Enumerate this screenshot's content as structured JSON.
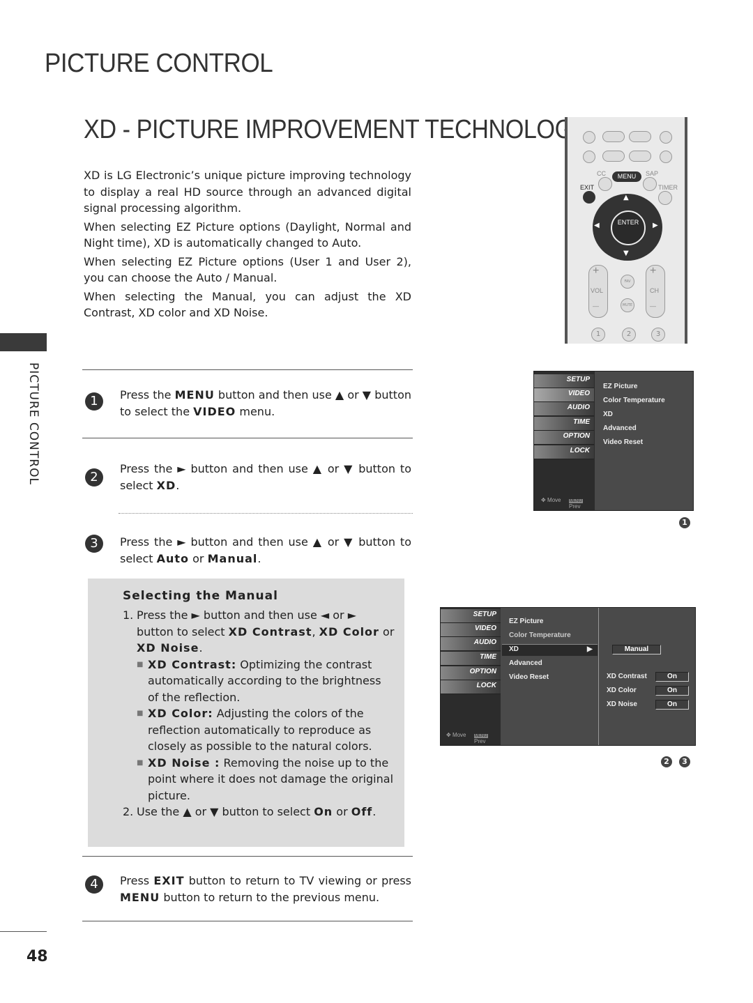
{
  "header": {
    "section_title": "PICTURE CONTROL",
    "page_title": "XD - PICTURE IMPROVEMENT TECHNOLOGY",
    "side_label": "PICTURE CONTROL",
    "page_number": "48"
  },
  "intro": [
    "XD is LG Electronic’s unique picture improving technology to display a real HD source through an advanced digital signal processing algorithm.",
    "When selecting EZ Picture options (Daylight, Normal and Night time), XD is automatically changed to Auto.",
    "When selecting EZ Picture options (User 1 and User 2), you can choose the Auto / Manual.",
    "When selecting the Manual, you can adjust the XD Contrast, XD color and XD Noise."
  ],
  "steps": [
    {
      "num": "1",
      "parts": [
        "Press the ",
        "MENU",
        " button and then use ▲ or ▼ button to select the ",
        "VIDEO",
        " menu."
      ]
    },
    {
      "num": "2",
      "parts": [
        "Press the ► button and then use ▲ or ▼ button to select ",
        "XD",
        "."
      ]
    },
    {
      "num": "3",
      "parts": [
        "Press the ► button and then use ▲ or ▼ button to select ",
        "Auto",
        " or ",
        "Manual",
        "."
      ]
    },
    {
      "num": "4",
      "parts": [
        "Press ",
        "EXIT",
        " button to return to TV viewing or press ",
        "MENU",
        " button to return to the previous menu."
      ]
    }
  ],
  "manual_box": {
    "title": "Selecting the Manual",
    "item1": {
      "num": "1.",
      "parts": [
        "Press the ► button and then use ◄ or ► button to select ",
        "XD Contrast",
        ", ",
        "XD Color",
        " or ",
        "XD Noise",
        "."
      ]
    },
    "bullets": [
      {
        "term": "XD Contrast:",
        "text": " Optimizing the contrast automatically according to the brightness of the reflection."
      },
      {
        "term": "XD Color:",
        "text": " Adjusting the colors of the reflection automatically to reproduce as closely as possible to the natural colors."
      },
      {
        "term": "XD Noise :",
        "text": " Removing the noise up to the point where it does not damage the original picture."
      }
    ],
    "item2": {
      "num": "2.",
      "parts": [
        "Use the ▲ or ▼ button to select ",
        "On",
        " or ",
        "Off",
        "."
      ]
    }
  },
  "remote": {
    "labels": {
      "cc": "CC",
      "menu": "MENU",
      "sap": "SAP",
      "exit": "EXIT",
      "timer": "TIMER",
      "enter": "ENTER",
      "vol": "VOL",
      "ch": "CH",
      "fav": "FAV",
      "mute": "MUTE",
      "plus": "+",
      "minus": "—"
    },
    "number_keys": [
      "1",
      "2",
      "3"
    ],
    "transport_icons": [
      "stop-icon",
      "play-icon",
      "pause-icon",
      "record-icon",
      "skip-back-icon",
      "rewind-icon",
      "fast-forward-icon",
      "skip-forward-icon"
    ]
  },
  "menu1": {
    "tabs": [
      "SETUP",
      "VIDEO",
      "AUDIO",
      "TIME",
      "OPTION",
      "LOCK"
    ],
    "active_tab": "VIDEO",
    "items": [
      "EZ Picture",
      "Color Temperature",
      "XD",
      "Advanced",
      "Video Reset"
    ],
    "footer_move": "Move",
    "footer_menu_key": "MENU",
    "footer_prev": "Prev",
    "callout": "1"
  },
  "menu2": {
    "tabs": [
      "SETUP",
      "VIDEO",
      "AUDIO",
      "TIME",
      "OPTION",
      "LOCK"
    ],
    "items": [
      "EZ Picture",
      "Color Temperature",
      "XD",
      "Advanced",
      "Video Reset"
    ],
    "selected_item": "XD",
    "xd_mode": "Manual",
    "settings": [
      {
        "label": "XD Contrast",
        "value": "On"
      },
      {
        "label": "XD Color",
        "value": "On"
      },
      {
        "label": "XD Noise",
        "value": "On"
      }
    ],
    "footer_move": "Move",
    "footer_menu_key": "MENU",
    "footer_prev": "Prev",
    "callouts": [
      "2",
      "3"
    ]
  }
}
